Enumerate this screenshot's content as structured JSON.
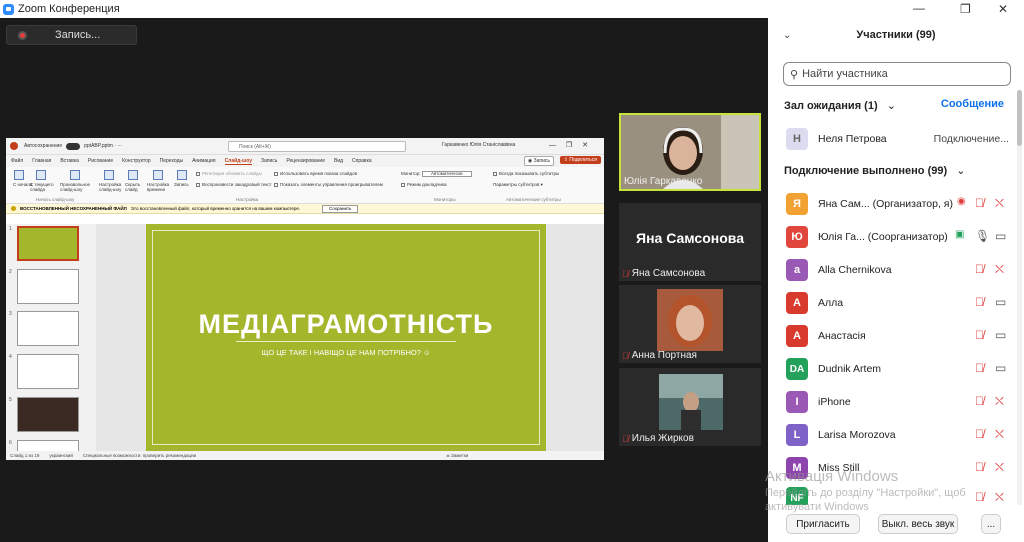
{
  "window": {
    "title": "Zoom Конференция",
    "controls": [
      "—",
      "❐",
      "✕"
    ]
  },
  "recording": {
    "label": "Запись..."
  },
  "ppt": {
    "autosave": "Автосохранение",
    "filename": "pptABP.pptm  ·  ···",
    "search_placeholder": "Поиск (Alt+Ж)",
    "user": "Гаркавенко Юлія Станіславівна",
    "tabs": [
      "Файл",
      "Главная",
      "Вставка",
      "Рисование",
      "Конструктор",
      "Переходы",
      "Анимация",
      "Слайд-шоу",
      "Запись",
      "Рецензирование",
      "Вид",
      "Справка"
    ],
    "active_tab": "Слайд-шоу",
    "record_btn": "◉ Запись",
    "share_btn": "⇧ Поделиться",
    "ribbon": {
      "btn_start": "С начала",
      "btn_current": "С текущего слайда",
      "btn_custom": "Произвольное слайд-шоу",
      "btn_setup": "Настройка слайд-шоу",
      "btn_hide": "Скрыть слайд",
      "btn_timing": "Настройка времени",
      "btn_record": "Запись",
      "cb_rehearse": "Репетиция обновить слайды",
      "cb_narration": "Воспроизвести закадровый текст",
      "cb_use_timing": "Использовать время показа слайдов",
      "cb_show_controls": "Показать элементы управления проигрывателем",
      "monitor_label": "Монитор:",
      "monitor_value": "Автоматически",
      "presenter_view": "Режим докладчика",
      "subtitles_always": "Всегда показывать субтитры",
      "subtitle_params": "Параметры субтитров ▾",
      "group_start": "Начать слайд-шоу",
      "group_setup": "Настройка",
      "group_monitors": "Мониторы",
      "group_captions": "Автоматические субтитры"
    },
    "warning": {
      "title": "ВОССТАНОВЛЕННЫЙ НЕСОХРАНЕННЫЙ ФАЙЛ",
      "text": "Это восстановленный файл, который временно хранится на вашем компьютере.",
      "button": "Сохранить"
    },
    "slide_numbers": [
      "1",
      "2",
      "3",
      "4",
      "5",
      "6"
    ],
    "slide": {
      "title": "МЕДІАГРАМОТНІСТЬ",
      "subtitle": "ЩО ЦЕ ТАКЕ І НАВІЩО ЦЕ НАМ ПОТРІБНО? ☺"
    },
    "status": {
      "slide_info": "Слайд 1 из 19",
      "language": "украинский",
      "accessibility": "Специальные возможности: проверить рекомендации",
      "notes": "≐ Заметки"
    }
  },
  "videos": [
    {
      "name": "Юлія Гаркавенко",
      "muted": false,
      "active": true
    },
    {
      "name": "Яна Самсонова",
      "big_label": "Яна Самсонова",
      "muted": true
    },
    {
      "name": "Анна Портная",
      "muted": true
    },
    {
      "name": "Илья Жирков",
      "muted": true
    }
  ],
  "panel": {
    "title": "Участники (99)",
    "search_placeholder": "Найти участника",
    "waiting_room": "Зал ожидания (1)",
    "message_link": "Сообщение",
    "waiting": [
      {
        "initial": "Н",
        "name": "Неля Петрова",
        "status": "Подключение...",
        "color": "#dcdcf0"
      }
    ],
    "connected_header": "Подключение выполнено (99)",
    "participants": [
      {
        "initial": "Я",
        "name": "Яна Сам...  (Организатор, я)",
        "color": "#f1a233"
      },
      {
        "initial": "Ю",
        "name": "Юлія Га...  (Соорганизатор)",
        "color": "#e0463b"
      },
      {
        "initial": "a",
        "name": "Alla Chernikova",
        "color": "#9b59b6"
      },
      {
        "initial": "А",
        "name": "Алла",
        "color": "#d83a2e"
      },
      {
        "initial": "А",
        "name": "Анастасія",
        "color": "#d83a2e"
      },
      {
        "initial": "DA",
        "name": "Dudnik Artem",
        "color": "#23a15a"
      },
      {
        "initial": "I",
        "name": "iPhone",
        "color": "#9b59b6"
      },
      {
        "initial": "L",
        "name": "Larisa Morozova",
        "color": "#7e62c7"
      },
      {
        "initial": "M",
        "name": "Miss Still",
        "color": "#8e44ad"
      },
      {
        "initial": "NF",
        "name": "",
        "color": "#23a15a"
      }
    ],
    "footer": {
      "invite": "Пригласить",
      "mute_all": "Выкл. весь звук",
      "more": "..."
    }
  },
  "watermark": {
    "line1": "Активація Windows",
    "line2": "Перейдіть до розділу \"Настройки\", щоб",
    "line3": "активувати Windows"
  },
  "colors": {
    "slide_bg": "#a4b62c",
    "zoom_blue": "#0e71eb",
    "mute_red": "#e03b3b",
    "active_speaker": "#c7e33b"
  }
}
